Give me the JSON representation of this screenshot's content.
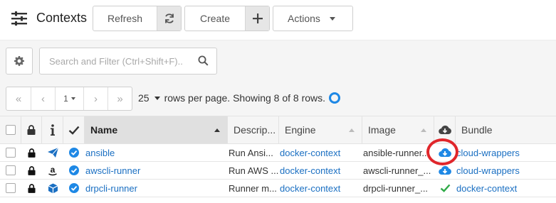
{
  "header": {
    "title": "Contexts",
    "refresh_label": "Refresh",
    "create_label": "Create",
    "actions_label": "Actions"
  },
  "search": {
    "placeholder": "Search and Filter (Ctrl+Shift+F).."
  },
  "pagination": {
    "first": "«",
    "prev": "‹",
    "page": "1",
    "next": "›",
    "last": "»",
    "rows_per_page": "25",
    "status_text": "rows per page. Showing 8 of 8 rows."
  },
  "table": {
    "columns": {
      "name": "Name",
      "description": "Descrip...",
      "engine": "Engine",
      "image": "Image",
      "bundle": "Bundle"
    },
    "sorted_column": "Name",
    "rows": [
      {
        "name": "ansible",
        "description": "Run Ansi...",
        "engine": "docker-context",
        "image": "ansible-runner...",
        "bundle": "cloud-wrappers",
        "row_icon": "paper-plane-icon",
        "image_status": "cloud-download-icon"
      },
      {
        "name": "awscli-runner",
        "description": "Run AWS ...",
        "engine": "docker-context",
        "image": "awscli-runner_...",
        "bundle": "cloud-wrappers",
        "row_icon": "amazon-icon",
        "image_status": "cloud-download-icon"
      },
      {
        "name": "drpcli-runner",
        "description": "Runner m...",
        "engine": "docker-context",
        "image": "drpcli-runner_...",
        "bundle": "docker-context",
        "row_icon": "cube-icon",
        "image_status": "check-icon"
      }
    ]
  },
  "colors": {
    "accent": "#1e88e5",
    "link": "#1a6fc2",
    "success": "#2eaa47",
    "highlight": "#e0262b"
  }
}
